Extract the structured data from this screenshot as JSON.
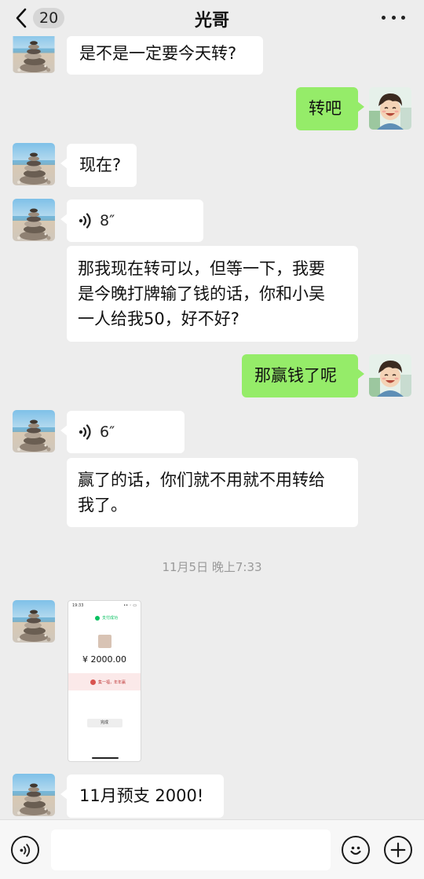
{
  "header": {
    "unread_count": "20",
    "title": "光哥"
  },
  "messages": {
    "m1": "是不是一定要今天转?",
    "m2": "转吧",
    "m3": "现在?",
    "m4_voice": "8″",
    "m5_line1": "那我现在转可以，但等一下，我要",
    "m5_line2": "是今晚打牌输了钱的话，你和小吴",
    "m5_line3": "一人给我50，好不好?",
    "m6": "那赢钱了呢",
    "m7_voice": "6″",
    "m8_line1": "赢了的话，你们就不用就不用转给",
    "m8_line2": "我了。",
    "timestamp": "11月5日 晚上7:33",
    "m10": "11月预支 2000!"
  },
  "screenshot": {
    "time": "19:33",
    "status": "支付成功",
    "amount": "¥ 2000.00",
    "promo": "集一福，年年赢",
    "done": "完成"
  },
  "icons": {
    "back": "chevron-left-icon",
    "more": "more-dots-icon",
    "voice": "voice-icon",
    "emoji": "emoji-icon",
    "add": "plus-icon"
  },
  "colors": {
    "sent_bubble": "#95ec69",
    "received_bubble": "#ffffff",
    "background": "#ededed"
  }
}
